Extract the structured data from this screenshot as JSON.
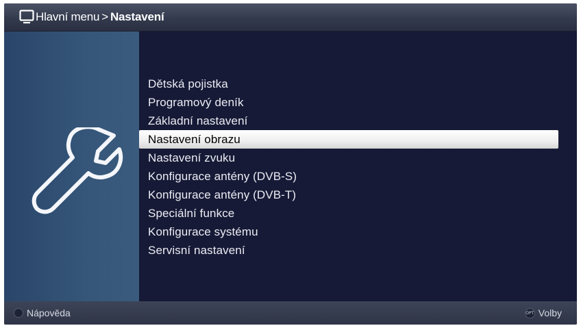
{
  "header": {
    "icon": "tv-icon",
    "breadcrumb_root": "Hlavní menu",
    "breadcrumb_separator": ">",
    "breadcrumb_current": "Nastavení"
  },
  "sidebar": {
    "icon": "wrench-icon"
  },
  "menu": {
    "items": [
      {
        "label": "Dětská pojistka"
      },
      {
        "label": "Programový deník"
      },
      {
        "label": "Základní nastavení"
      },
      {
        "label": "Nastavení obrazu"
      },
      {
        "label": "Nastavení zvuku"
      },
      {
        "label": "Konfigurace antény (DVB-S)"
      },
      {
        "label": "Konfigurace antény (DVB-T)"
      },
      {
        "label": "Speciální funkce"
      },
      {
        "label": "Konfigurace systému"
      },
      {
        "label": "Servisní nastavení"
      }
    ],
    "selected_index": 3
  },
  "footer": {
    "help_label": "Nápověda",
    "options_key_glyph": "OPT",
    "options_label": "Volby"
  },
  "colors": {
    "background": "#161a36",
    "header": "#3a4154",
    "sidebar": "#355679",
    "selection": "#eeeeee",
    "text": "#ececf4"
  }
}
